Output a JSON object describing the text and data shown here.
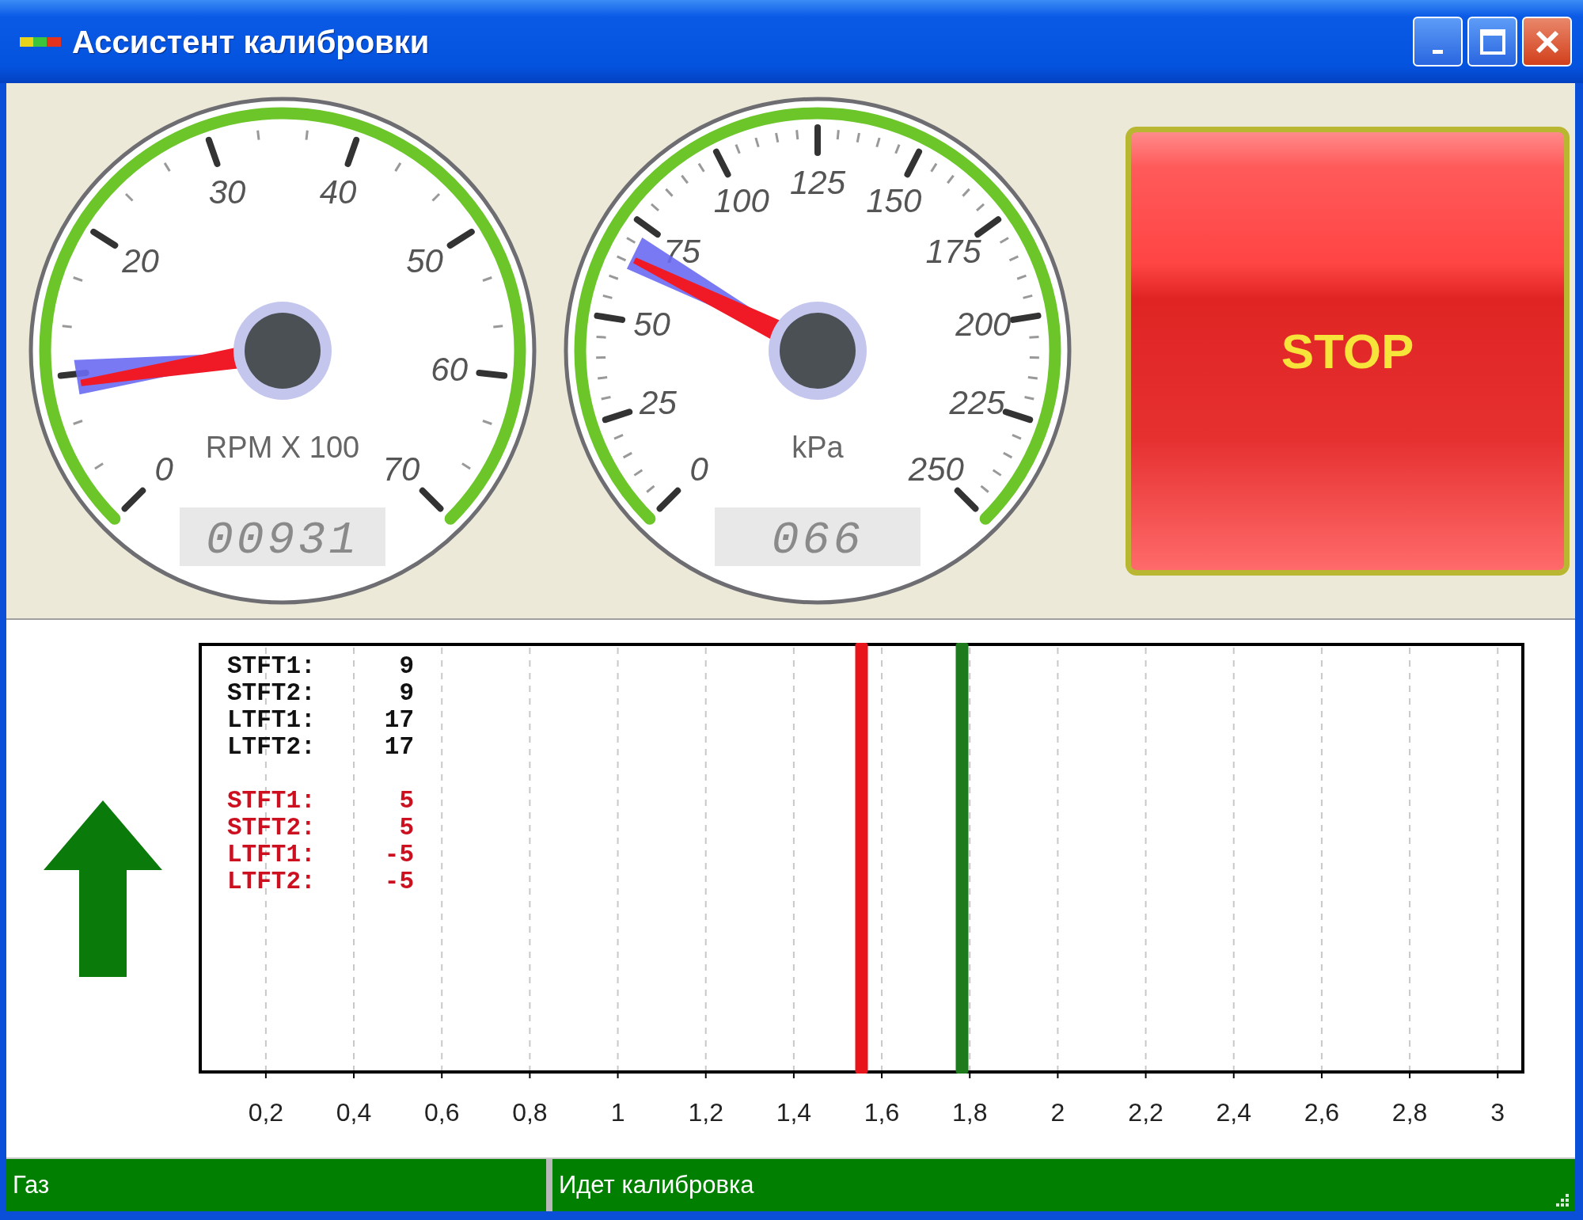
{
  "window": {
    "title": "Ассистент калибровки"
  },
  "gauges": [
    {
      "ticks": [
        {
          "kind": "labelled",
          "label": "0"
        },
        {
          "kind": "plain"
        },
        {
          "kind": "labelled",
          "label": "20"
        },
        {
          "kind": "labelled",
          "label": "30"
        },
        {
          "kind": "labelled",
          "label": "40"
        },
        {
          "kind": "labelled",
          "label": "50"
        },
        {
          "kind": "labelled",
          "label": "60"
        },
        {
          "kind": "labelled",
          "label": "70"
        }
      ],
      "unit": "RPM X 100",
      "readout": "00931",
      "level": 0.133
    },
    {
      "ticks": [
        {
          "kind": "labelled",
          "label": "0"
        },
        {
          "kind": "labelled",
          "label": "25"
        },
        {
          "kind": "labelled",
          "label": "50"
        },
        {
          "kind": "labelled",
          "label": "75"
        },
        {
          "kind": "labelled",
          "label": "100"
        },
        {
          "kind": "labelled",
          "label": "125"
        },
        {
          "kind": "labelled",
          "label": "150"
        },
        {
          "kind": "labelled",
          "label": "175"
        },
        {
          "kind": "labelled",
          "label": "200"
        },
        {
          "kind": "labelled",
          "label": "225"
        },
        {
          "kind": "labelled",
          "label": "250"
        }
      ],
      "unit": "kPa",
      "readout": "066",
      "level": 0.264
    }
  ],
  "stop_button": {
    "label": "STOP"
  },
  "direction_arrow": {
    "kind": "up"
  },
  "trim_groups": [
    {
      "color": "#111111",
      "rows": [
        {
          "label": "STFT1:",
          "value": "9"
        },
        {
          "label": "STFT2:",
          "value": "9"
        },
        {
          "label": "LTFT1:",
          "value": "17"
        },
        {
          "label": "LTFT2:",
          "value": "17"
        }
      ]
    },
    {
      "color": "#cc1020",
      "rows": [
        {
          "label": "STFT1:",
          "value": "5"
        },
        {
          "label": "STFT2:",
          "value": "5"
        },
        {
          "label": "LTFT1:",
          "value": "-5"
        },
        {
          "label": "LTFT2:",
          "value": "-5"
        }
      ]
    }
  ],
  "scale": {
    "labels": [
      "0,2",
      "0,4",
      "0,6",
      "0,8",
      "1",
      "1,2",
      "1,4",
      "1,6",
      "1,8",
      "2",
      "2,2",
      "2,4",
      "2,6",
      "2,8",
      "3"
    ],
    "markers": [
      {
        "color": "#e8141c",
        "level": 0.5
      },
      {
        "color": "#1d7a1d",
        "level": 0.576
      }
    ]
  },
  "status_bar": [
    "Газ",
    "Идет калибровка"
  ]
}
